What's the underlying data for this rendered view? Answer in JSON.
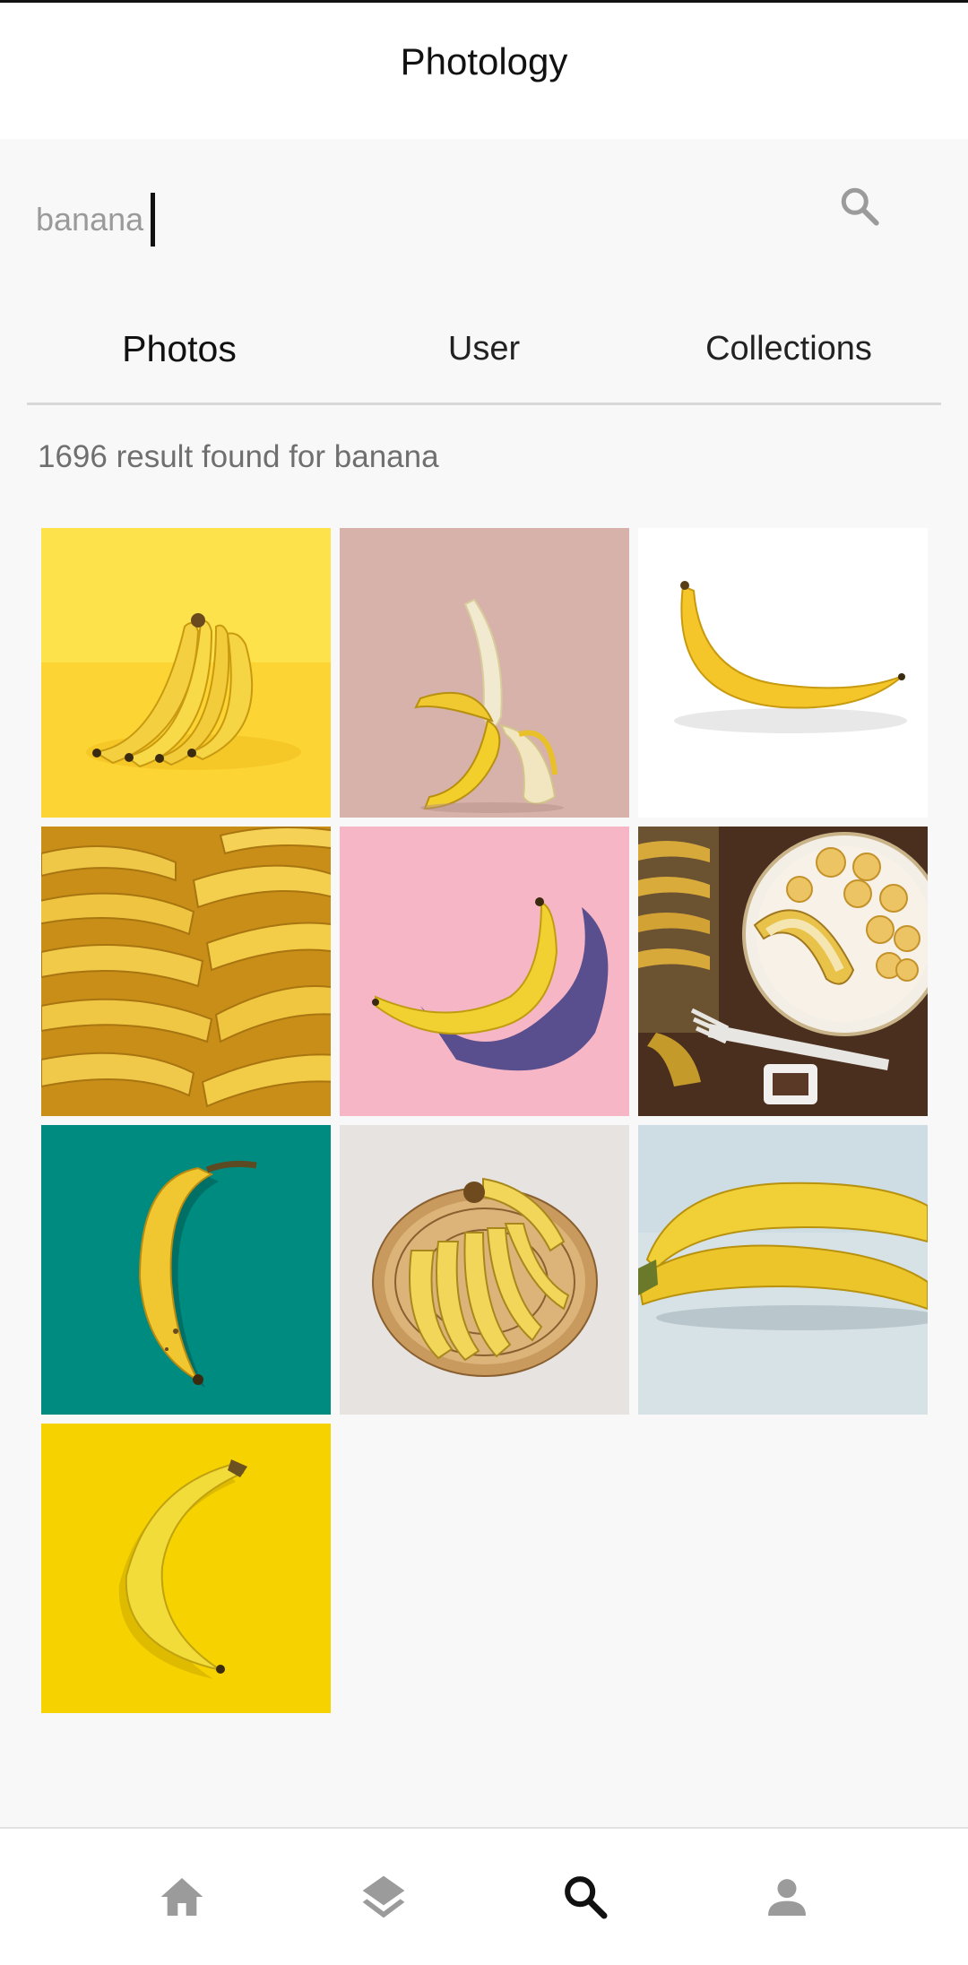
{
  "app": {
    "title": "Photology"
  },
  "search": {
    "value": "banana",
    "icon": "search-icon"
  },
  "tabs": [
    {
      "label": "Photos",
      "active": true
    },
    {
      "label": "User",
      "active": false
    },
    {
      "label": "Collections",
      "active": false
    }
  ],
  "results": {
    "summary": "1696 result found for banana"
  },
  "photos": [
    {
      "subject": "bunch of bananas on yellow background",
      "bg": "#fcd83a"
    },
    {
      "subject": "peeled banana on pink background",
      "bg": "#d7b1aa"
    },
    {
      "subject": "single banana on white background",
      "bg": "#ffffff"
    },
    {
      "subject": "pile of bananas",
      "bg": "#e3ad2a"
    },
    {
      "subject": "banana on pink background with shadow",
      "bg": "#f6b7c6"
    },
    {
      "subject": "sliced banana on plate with fork",
      "bg": "#4a3322"
    },
    {
      "subject": "banana on teal background",
      "bg": "#008a7e"
    },
    {
      "subject": "bananas in wicker basket",
      "bg": "#e7e3e0"
    },
    {
      "subject": "two bananas on light blue background",
      "bg": "#d3dfe3"
    },
    {
      "subject": "banana on yellow background",
      "bg": "#f4d000"
    }
  ],
  "bottom_nav": [
    {
      "icon": "home-icon",
      "active": false
    },
    {
      "icon": "layers-icon",
      "active": false
    },
    {
      "icon": "search-icon",
      "active": true
    },
    {
      "icon": "person-icon",
      "active": false
    }
  ],
  "colors": {
    "active_icon": "#111111",
    "inactive_icon": "#9b9b9b",
    "background": "#f8f8f8"
  }
}
